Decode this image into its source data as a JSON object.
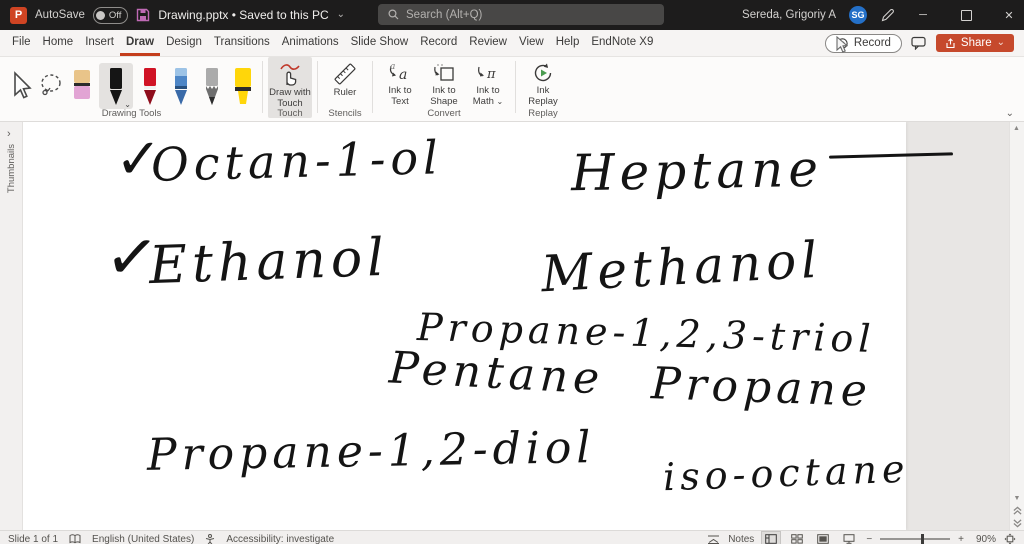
{
  "titlebar": {
    "logo_letter": "P",
    "autosave_label": "AutoSave",
    "autosave_state": "Off",
    "document_title": "Drawing.pptx • Saved to this PC",
    "search_placeholder": "Search (Alt+Q)",
    "user_name": "Sereda, Grigoriy A",
    "user_initials": "SG"
  },
  "ribbon": {
    "tabs": [
      "File",
      "Home",
      "Insert",
      "Draw",
      "Design",
      "Transitions",
      "Animations",
      "Slide Show",
      "Record",
      "Review",
      "View",
      "Help",
      "EndNote X9"
    ],
    "active_tab": "Draw",
    "record_button_label": "Record",
    "share_button_label": "Share",
    "groups": {
      "drawing_tools_label": "Drawing Tools",
      "touch_label": "Touch",
      "touch_button": "Draw with Touch",
      "stencils_label": "Stencils",
      "ruler_button": "Ruler",
      "convert_label": "Convert",
      "ink_to_text": "Ink to Text",
      "ink_to_shape": "Ink to Shape",
      "ink_to_math": "Ink to Math",
      "replay_label": "Replay",
      "ink_replay": "Ink Replay"
    },
    "pen_tools": [
      "select",
      "lasso-select",
      "eraser",
      "black-pen (selected)",
      "red-pen",
      "blue-pen",
      "silver-pencil",
      "yellow-highlighter"
    ]
  },
  "thumbnails_pane": {
    "label": "Thumbnails"
  },
  "slide": {
    "checks": [
      "✓",
      "✓"
    ],
    "items": [
      "Octan-1-ol",
      "Heptane",
      "Ethanol",
      "Methanol",
      "Propane-1,2,3-triol",
      "Pentane",
      "Propane",
      "Propane-1,2-diol",
      "iso-octane"
    ],
    "strokes": [
      {
        "type": "horizontal-line",
        "position": "above-right-of-Heptane"
      }
    ]
  },
  "statusbar": {
    "slide_indicator": "Slide 1 of 1",
    "language": "English (United States)",
    "accessibility": "Accessibility: investigate",
    "notes_label": "Notes",
    "zoom_level": "90%"
  },
  "icons": {
    "chevron_down": "⌄",
    "minimize": "─",
    "close": "✕",
    "scroll_up": "▲",
    "scroll_down": "▼",
    "prev_slide": "▲▲",
    "next_slide": "▼▼",
    "zoom_out": "−",
    "zoom_in": "+",
    "pane_chevron": "›"
  },
  "colors": {
    "titlebar_bg": "#1d1c1c",
    "share_accent": "#c6492c",
    "tab_underline": "#c43e1c",
    "user_badge": "#2470c8"
  }
}
